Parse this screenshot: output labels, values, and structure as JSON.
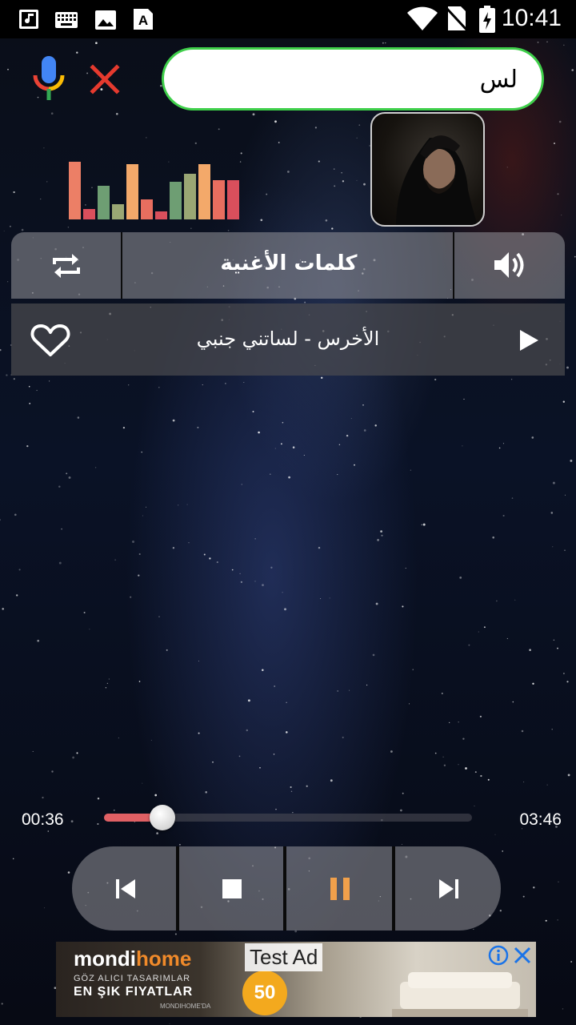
{
  "status_bar": {
    "time": "10:41",
    "left_icons": [
      "music-note-icon",
      "keyboard-icon",
      "image-icon",
      "font-a-icon"
    ],
    "right_icons": [
      "wifi-icon",
      "no-sim-icon",
      "battery-charging-icon"
    ]
  },
  "search": {
    "query": "لس",
    "mic_icon": "google-mic-icon",
    "clear_icon": "close-icon"
  },
  "controls": {
    "repeat_icon": "repeat-icon",
    "lyrics_label": "كلمات الأغنية",
    "volume_icon": "volume-icon"
  },
  "song": {
    "title": "الأخرس - لساتني جنبي",
    "favorite_icon": "heart-outline-icon",
    "play_icon": "play-icon"
  },
  "player": {
    "current_time": "00:36",
    "total_time": "03:46",
    "progress": 0.159,
    "buttons": [
      "skip-previous-icon",
      "stop-icon",
      "pause-icon",
      "skip-next-icon"
    ]
  },
  "equalizer": {
    "levels": [
      0.97,
      0.17,
      0.57,
      0.26,
      0.93,
      0.34,
      0.13,
      0.64,
      0.77,
      0.93,
      0.66,
      0.66
    ],
    "colors": [
      "#ec7f66",
      "#d94f5c",
      "#6e9e73",
      "#9aa774",
      "#f3a96a",
      "#e86e5f",
      "#d94f5c",
      "#6e9e73",
      "#9aa774",
      "#f3a96a",
      "#e86e5f",
      "#d94f5c"
    ]
  },
  "ad": {
    "brand_first": "mondi",
    "brand_second": "home",
    "line1": "GÖZ ALICI TASARIMLAR",
    "line2": "EN ŞIK FIYATLAR",
    "line3": "MONDIHOME'DA",
    "label": "Test Ad",
    "badge": "50",
    "info_icon": "info-icon",
    "close_icon": "close-icon"
  },
  "colors": {
    "accent_green": "#3fcf4a",
    "progress_fill": "#e06064",
    "pause_accent": "#f0a04b"
  }
}
